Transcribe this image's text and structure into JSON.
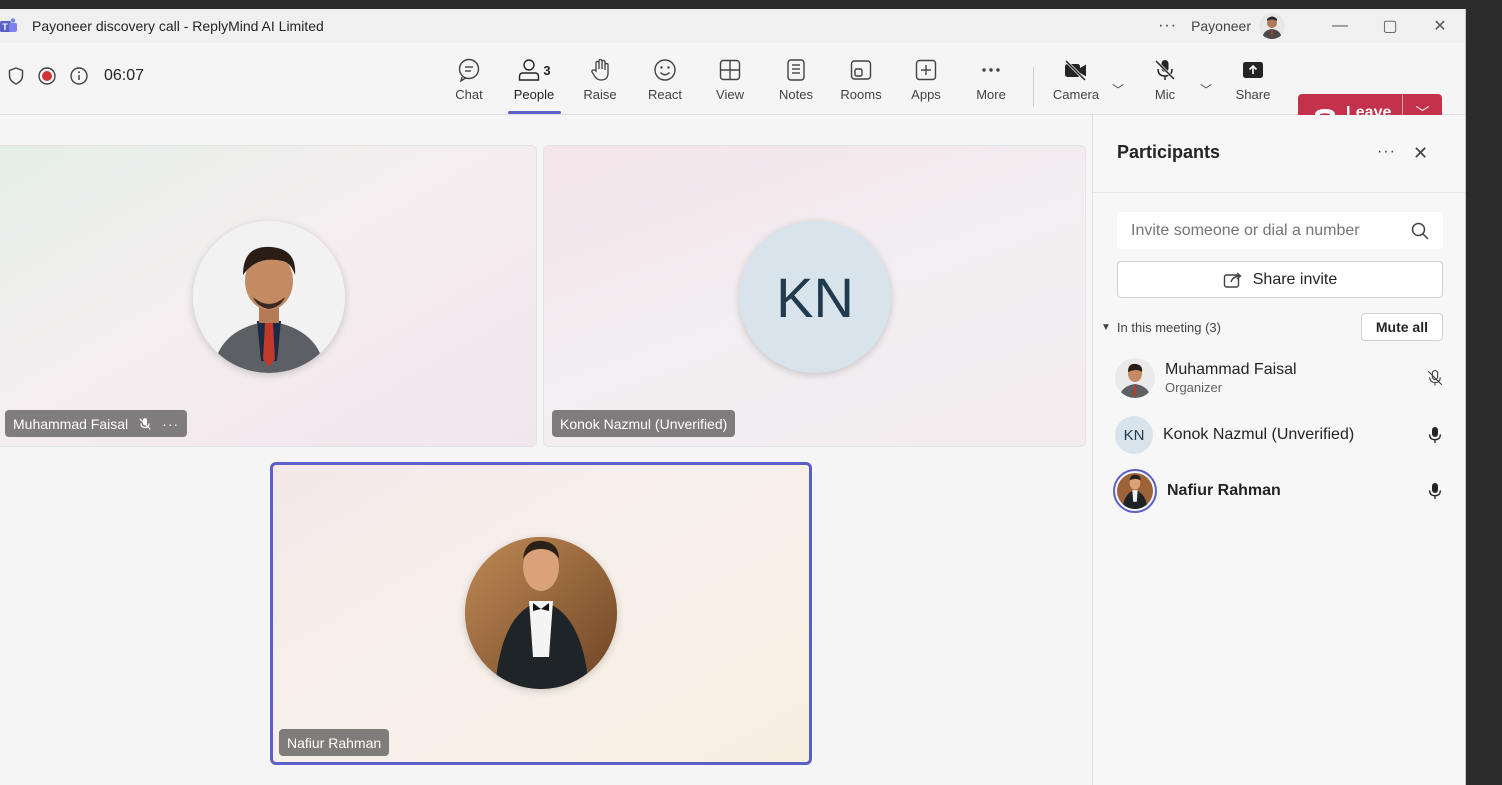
{
  "window": {
    "title": "Payoneer discovery call - ReplyMind AI Limited",
    "org_name": "Payoneer",
    "app_icon": "teams-icon",
    "controls": [
      "minimize-icon",
      "maximize-icon",
      "close-icon"
    ]
  },
  "meeting": {
    "elapsed_time": "06:07",
    "status_icons": [
      "shield-icon",
      "recording-icon",
      "info-icon"
    ]
  },
  "toolbar": {
    "chat_label": "Chat",
    "people_label": "People",
    "people_count": "3",
    "raise_label": "Raise",
    "react_label": "React",
    "view_label": "View",
    "notes_label": "Notes",
    "rooms_label": "Rooms",
    "apps_label": "Apps",
    "more_label": "More",
    "camera_label": "Camera",
    "mic_label": "Mic",
    "share_label": "Share",
    "leave_label": "Leave",
    "leave_color": "#c4314b",
    "accent_color": "#5b5fc7"
  },
  "stage": {
    "tiles": [
      {
        "name": "Muhammad Faisal",
        "muted": true
      },
      {
        "name": "Konok Nazmul (Unverified)",
        "initials": "KN"
      },
      {
        "name": "Nafiur Rahman",
        "active_speaker": true
      }
    ]
  },
  "panel": {
    "title": "Participants",
    "search_placeholder": "Invite someone or dial a number",
    "share_invite_label": "Share invite",
    "section_label": "In this meeting (3)",
    "mute_all_label": "Mute all",
    "participants": [
      {
        "name": "Muhammad Faisal",
        "role": "Organizer",
        "mic": "muted"
      },
      {
        "name": "Konok Nazmul (Unverified)",
        "initials": "KN",
        "mic": "on"
      },
      {
        "name": "Nafiur Rahman",
        "mic": "on"
      }
    ]
  }
}
